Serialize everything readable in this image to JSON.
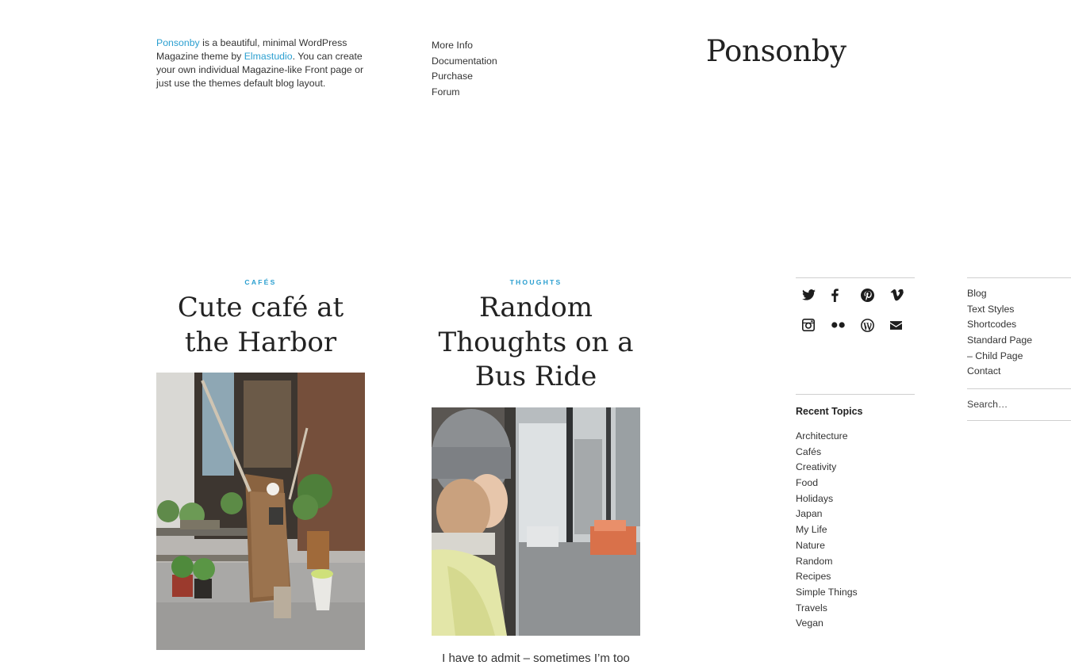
{
  "intro": {
    "brand_link": "Ponsonby",
    "text_1": " is a beautiful, minimal WordPress Magazine theme by ",
    "author_link": "Elmastudio",
    "text_2": ". You can create your own individual Magazine-like Front page or just use the themes default blog layout."
  },
  "top_menu": [
    "More Info",
    "Documentation",
    "Purchase",
    "Forum"
  ],
  "site_title": "Ponsonby",
  "posts": [
    {
      "category": "CAFÉS",
      "title": "Cute café at the Harbor",
      "excerpt": ""
    },
    {
      "category": "THOUGHTS",
      "title": "Random Thoughts on a Bus Ride",
      "excerpt": "I have to admit – sometimes I’m too"
    }
  ],
  "social_icons": [
    "twitter-icon",
    "facebook-icon",
    "pinterest-icon",
    "vimeo-icon",
    "instagram-icon",
    "flickr-icon",
    "wordpress-icon",
    "email-icon"
  ],
  "recent_topics": {
    "title": "Recent Topics",
    "items": [
      "Architecture",
      "Cafés",
      "Creativity",
      "Food",
      "Holidays",
      "Japan",
      "My Life",
      "Nature",
      "Random",
      "Recipes",
      "Simple Things",
      "Travels",
      "Vegan"
    ]
  },
  "page_menu": [
    "Blog",
    "Text Styles",
    "Shortcodes",
    "Standard Page",
    "– Child Page",
    "Contact"
  ],
  "search": {
    "placeholder": "Search…"
  },
  "colors": {
    "accent": "#2b9fd0",
    "text": "#222222",
    "rule": "#cfcfcf"
  }
}
